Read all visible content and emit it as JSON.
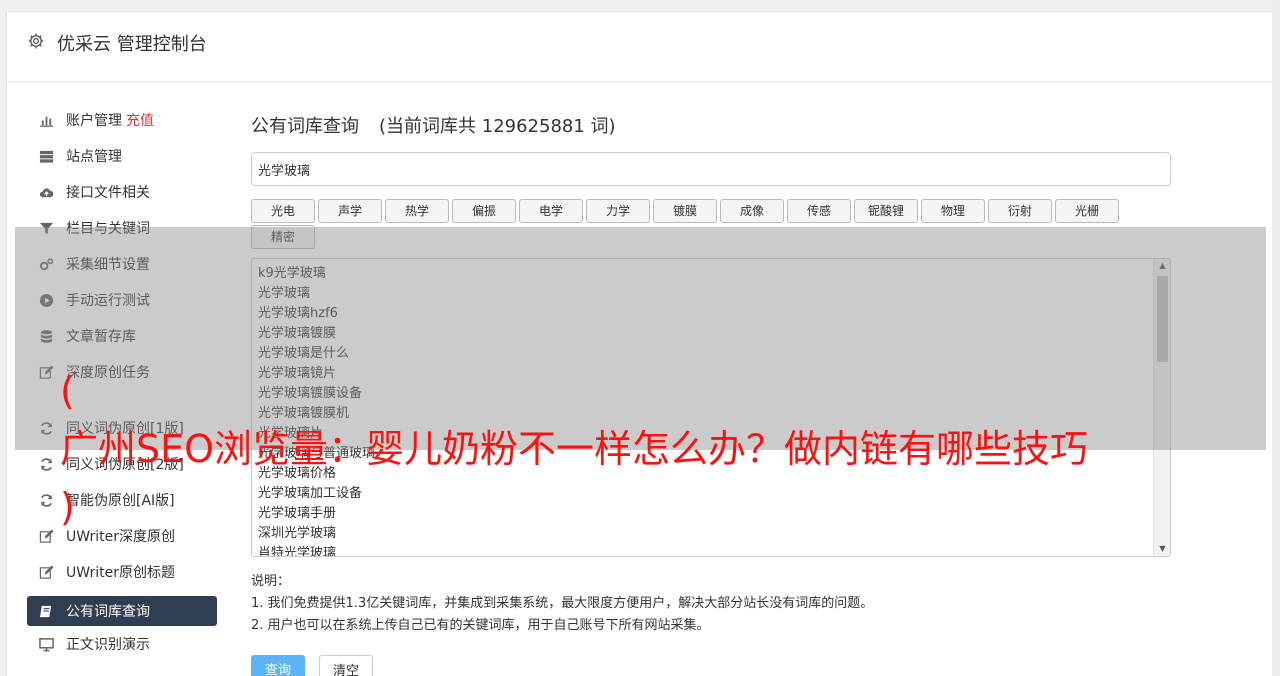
{
  "app": {
    "title": "优采云 管理控制台"
  },
  "sidebar": {
    "items": [
      {
        "label": "账户管理",
        "badge": "充值",
        "icon": "bar-chart-icon"
      },
      {
        "label": "站点管理",
        "icon": "server-icon"
      },
      {
        "label": "接口文件相关",
        "icon": "cloud-upload-icon"
      },
      {
        "label": "栏目与关键词",
        "icon": "filter-icon"
      },
      {
        "label": "采集细节设置",
        "icon": "cogs-icon"
      },
      {
        "label": "手动运行测试",
        "icon": "play-circle-icon"
      },
      {
        "label": "文章暂存库",
        "icon": "database-icon"
      },
      {
        "label": "深度原创任务",
        "icon": "edit-icon"
      }
    ],
    "items2": [
      {
        "label": "同义词伪原创[1版]",
        "icon": "refresh-icon"
      },
      {
        "label": "同义词伪原创[2版]",
        "icon": "refresh-icon"
      },
      {
        "label": "智能伪原创[AI版]",
        "icon": "refresh-icon"
      },
      {
        "label": "UWriter深度原创",
        "icon": "edit-icon"
      },
      {
        "label": "UWriter原创标题",
        "icon": "edit-icon"
      }
    ],
    "active": {
      "label": "公有词库查询",
      "icon": "book-icon"
    },
    "after": {
      "label": "正文识别演示",
      "icon": "monitor-icon"
    }
  },
  "main": {
    "title": "公有词库查询",
    "count_text": "(当前词库共 129625881 词)",
    "search_value": "光学玻璃",
    "tags": [
      "光电",
      "声学",
      "热学",
      "偏振",
      "电学",
      "力学",
      "镀膜",
      "成像",
      "传感",
      "铌酸锂",
      "物理",
      "衍射",
      "光栅",
      "精密"
    ],
    "results": [
      "k9光学玻璃",
      "光学玻璃",
      "光学玻璃hzf6",
      "光学玻璃镀膜",
      "光学玻璃是什么",
      "光学玻璃镜片",
      "光学玻璃镀膜设备",
      "光学玻璃镀膜机",
      "光学玻璃片",
      "光学玻璃与普通玻璃",
      "光学玻璃价格",
      "光学玻璃加工设备",
      "光学玻璃手册",
      "深圳光学玻璃",
      "肖特光学玻璃"
    ],
    "note_title": "说明：",
    "notes": [
      "1. 我们免费提供1.3亿关键词库，并集成到采集系统，最大限度方便用户，解决大部分站长没有词库的问题。",
      "2. 用户也可以在系统上传自己已有的关键词库，用于自己账号下所有网站采集。"
    ],
    "query_button": "查询",
    "clear_button": "清空"
  },
  "overlay": {
    "text": "(\n广州SEO浏览量：婴儿奶粉不一样怎么办？做内链有哪些技巧\n)"
  },
  "colors": {
    "active_bg": "#2f3e53",
    "accent": "#5bb4f5",
    "badge": "#e5322d",
    "overlay_text": "#ff1010"
  }
}
